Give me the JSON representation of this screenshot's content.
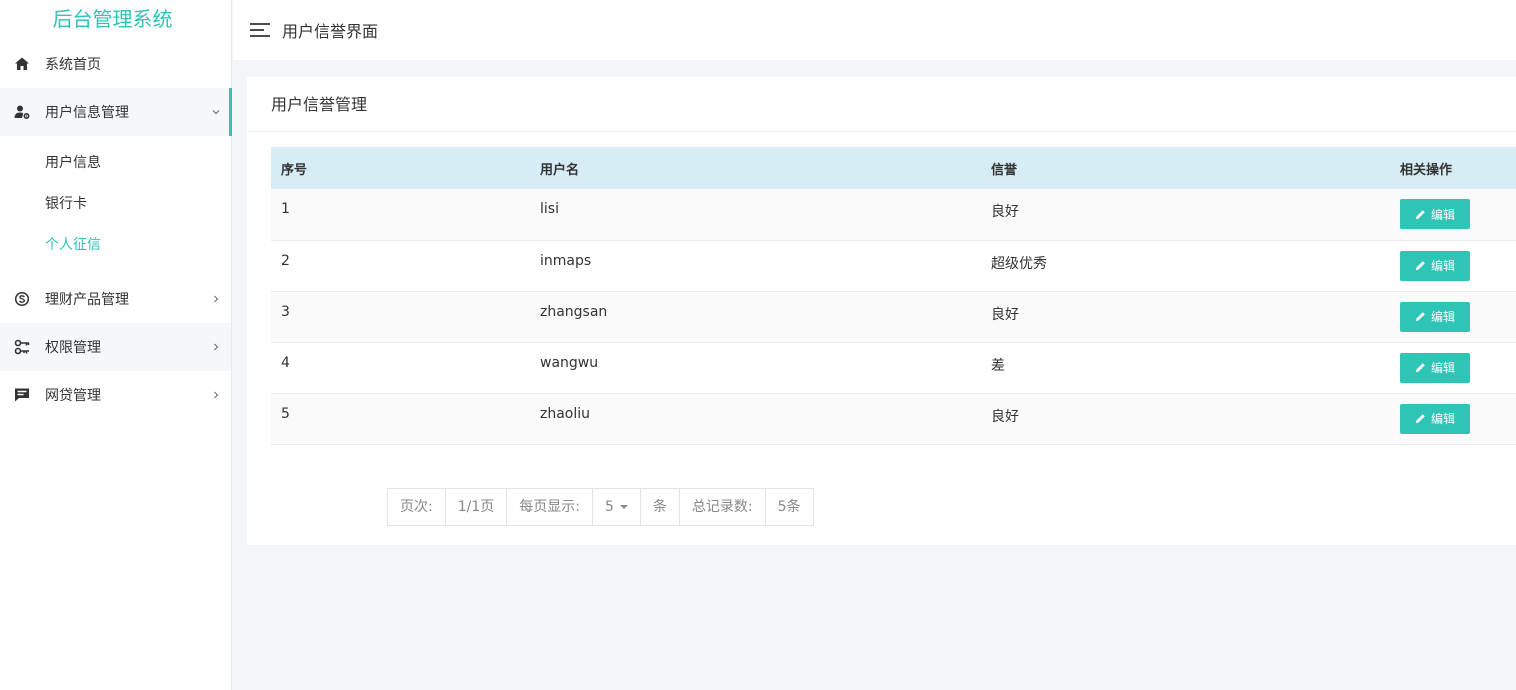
{
  "brand": "后台管理系统",
  "topbar": {
    "title": "用户信誉界面"
  },
  "sidebar": {
    "items": [
      {
        "label": "系统首页",
        "icon": "home-icon"
      },
      {
        "label": "用户信息管理",
        "icon": "user-settings-icon",
        "expanded": true,
        "children": [
          {
            "label": "用户信息"
          },
          {
            "label": "银行卡"
          },
          {
            "label": "个人征信",
            "active": true
          }
        ]
      },
      {
        "label": "理财产品管理",
        "icon": "skype-icon"
      },
      {
        "label": "权限管理",
        "icon": "key-icon"
      },
      {
        "label": "网贷管理",
        "icon": "message-icon"
      }
    ]
  },
  "card": {
    "title": "用户信誉管理"
  },
  "table": {
    "headers": [
      "序号",
      "用户名",
      "信誉",
      "相关操作"
    ],
    "rows": [
      {
        "id": "1",
        "username": "lisi",
        "credit": "良好"
      },
      {
        "id": "2",
        "username": "inmaps",
        "credit": "超级优秀"
      },
      {
        "id": "3",
        "username": "zhangsan",
        "credit": "良好"
      },
      {
        "id": "4",
        "username": "wangwu",
        "credit": "差"
      },
      {
        "id": "5",
        "username": "zhaoliu",
        "credit": "良好"
      }
    ],
    "edit_label": "编辑"
  },
  "pager": {
    "page_label": "页次:",
    "page_value": "1/1页",
    "per_page_label": "每页显示:",
    "per_page_value": "5",
    "unit": "条",
    "total_label": "总记录数:",
    "total_value": "5条"
  },
  "colors": {
    "accent": "#2ec4b6",
    "header_bg": "#d7edf5"
  }
}
